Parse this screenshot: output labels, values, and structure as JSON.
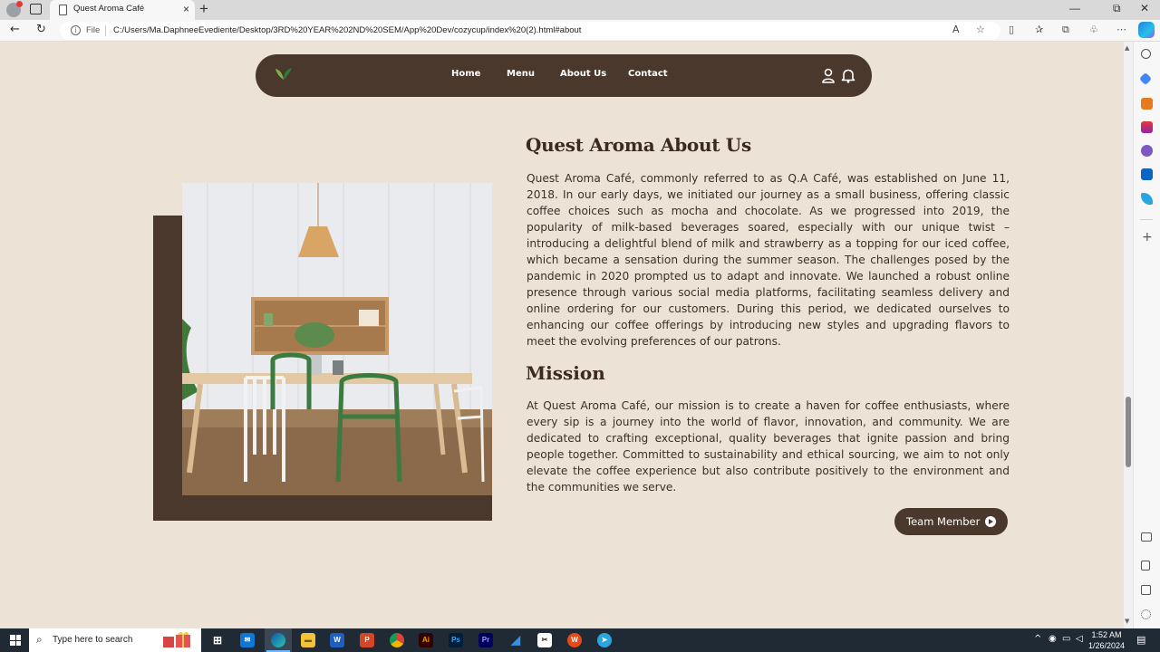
{
  "browser": {
    "tab_title": "Quest Aroma Café",
    "tab_close": "×",
    "new_tab": "+",
    "file_label": "File",
    "url": "C:/Users/Ma.DaphneeEvediente/Desktop/3RD%20YEAR%202ND%20SEM/App%20Dev/cozycup/index%20(2).html#about",
    "win_min": "—",
    "win_max": "⧉",
    "win_close": "✕"
  },
  "navbar": {
    "links": [
      "Home",
      "Menu",
      "About Us",
      "Contact"
    ]
  },
  "about": {
    "heading": "Quest Aroma About Us",
    "body": "Quest Aroma Café, commonly referred to as Q.A Café, was established on June 11, 2018. In our early days, we initiated our journey as a small business, offering classic coffee choices such as mocha and chocolate. As we progressed into 2019, the popularity of milk-based beverages soared, especially with our unique twist – introducing a delightful blend of milk and strawberry as a topping for our iced coffee, which became a sensation during the summer season. The challenges posed by the pandemic in 2020 prompted us to adapt and innovate. We launched a robust online presence through various social media platforms, facilitating seamless delivery and online ordering for our customers. During this period, we dedicated ourselves to enhancing our coffee offerings by introducing new styles and upgrading flavors to meet the evolving preferences of our patrons."
  },
  "mission": {
    "heading": "Mission",
    "body": "At Quest Aroma Café, our mission is to create a haven for coffee enthusiasts, where every sip is a journey into the world of flavor, innovation, and community. We are dedicated to crafting exceptional, quality beverages that ignite passion and bring people together. Committed to sustainability and ethical sourcing, we aim to not only elevate the coffee experience but also contribute positively to the environment and the communities we serve.",
    "button_label": "Team Member"
  },
  "taskbar": {
    "search_placeholder": "Type here to search",
    "time": "1:52 AM",
    "date": "1/26/2024"
  },
  "colors": {
    "page_bg": "#ece2d5",
    "brown": "#4a382d",
    "heading": "#3d2a1f"
  }
}
